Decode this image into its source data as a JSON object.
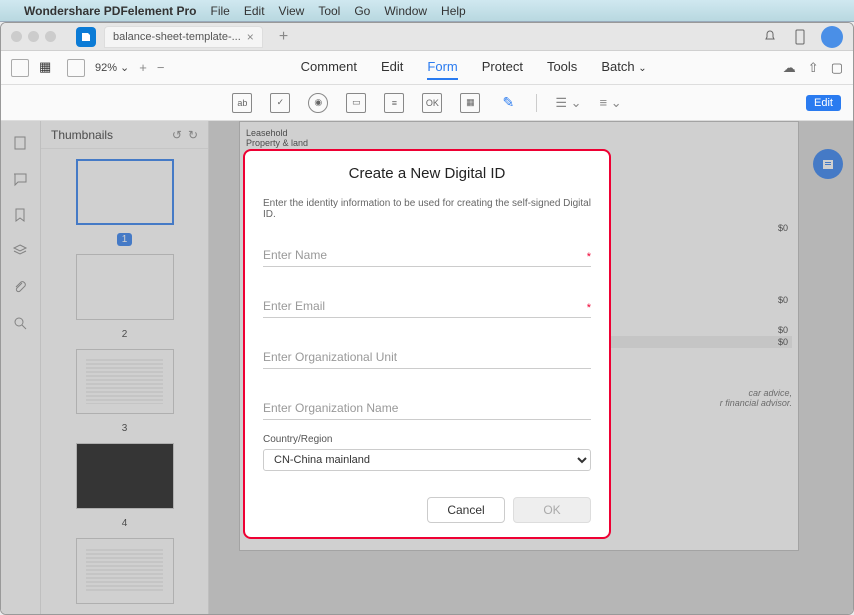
{
  "menu": {
    "app_name": "Wondershare PDFelement Pro",
    "items": [
      "File",
      "Edit",
      "View",
      "Tool",
      "Go",
      "Window",
      "Help"
    ]
  },
  "tab": {
    "title": "balance-sheet-template-..."
  },
  "zoom": "92%",
  "main_tabs": [
    {
      "label": "Comment"
    },
    {
      "label": "Edit"
    },
    {
      "label": "Form",
      "active": true
    },
    {
      "label": "Protect"
    },
    {
      "label": "Tools"
    },
    {
      "label": "Batch"
    }
  ],
  "edit_button": "Edit",
  "thumbnails": {
    "title": "Thumbnails",
    "pages": [
      "1",
      "2",
      "3",
      "4"
    ]
  },
  "doc": {
    "lines": [
      "Leasehold",
      "Property & land"
    ],
    "cells": [
      "$0",
      "$0"
    ],
    "note1": "car advice,",
    "note2": "r financial advisor."
  },
  "modal": {
    "title": "Create a New Digital ID",
    "desc": "Enter the identity information to be used for creating the self-signed Digital ID.",
    "name_placeholder": "Enter Name",
    "email_placeholder": "Enter Email",
    "org_unit_placeholder": "Enter Organizational Unit",
    "org_name_placeholder": "Enter Organization Name",
    "country_label": "Country/Region",
    "country_value": "CN-China mainland",
    "cancel": "Cancel",
    "ok": "OK"
  }
}
